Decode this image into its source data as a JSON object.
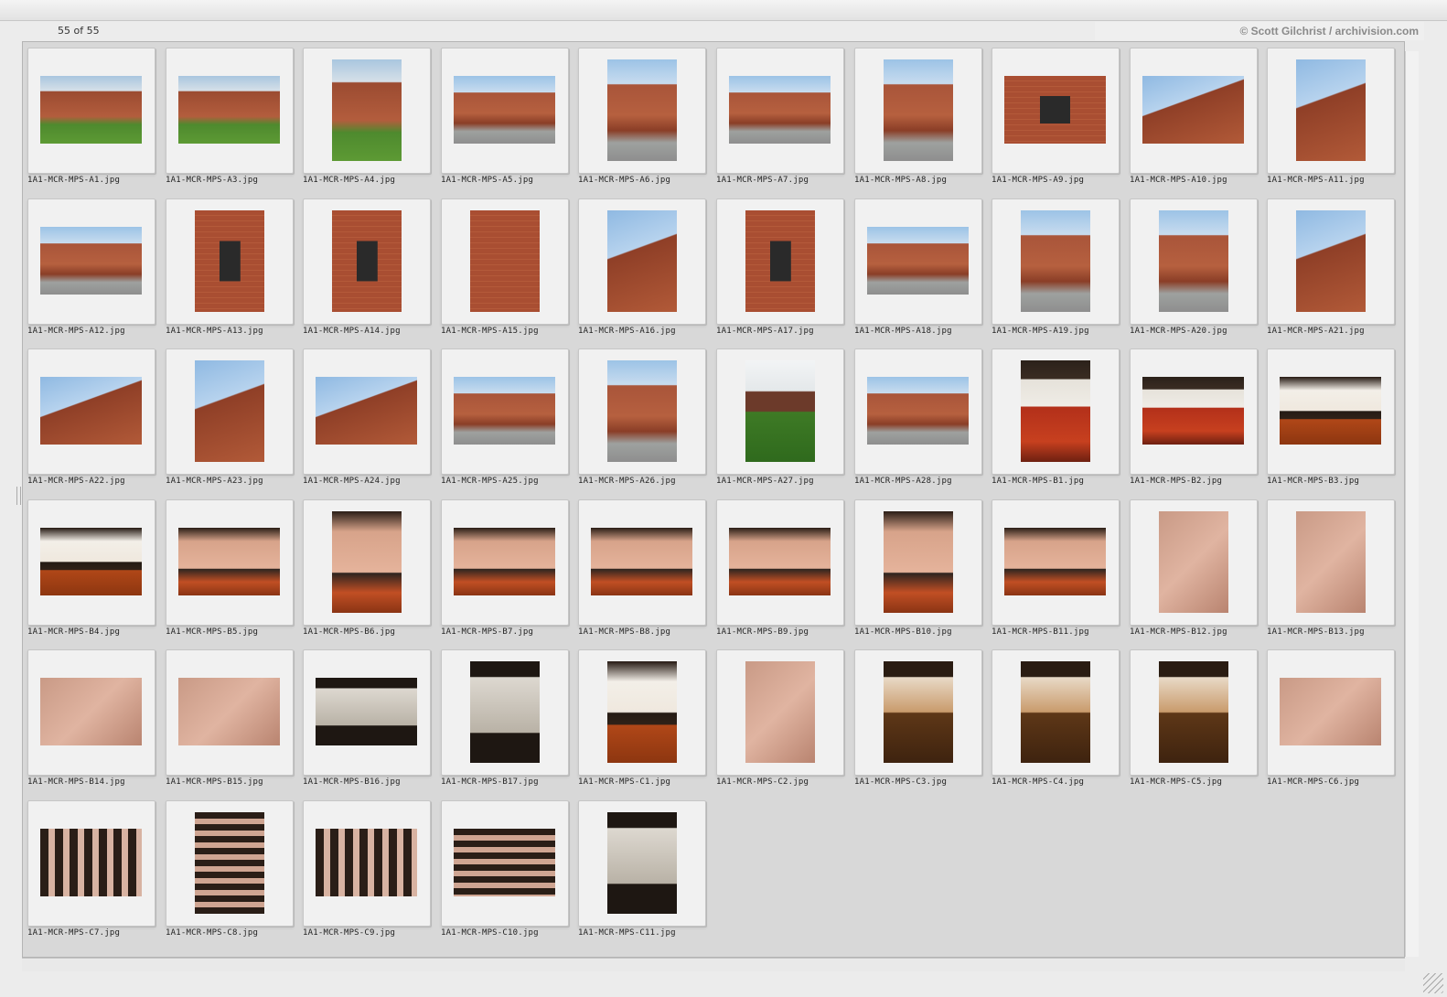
{
  "header": {
    "count_label": "55 of 55",
    "credit": "© Scott Gilchrist / archivision.com"
  },
  "images": [
    {
      "file": "1A1-MCR-MPS-A1.jpg",
      "orientation": "landscape",
      "tone": "exterior-green"
    },
    {
      "file": "1A1-MCR-MPS-A3.jpg",
      "orientation": "landscape",
      "tone": "exterior-green"
    },
    {
      "file": "1A1-MCR-MPS-A4.jpg",
      "orientation": "portrait",
      "tone": "exterior-green"
    },
    {
      "file": "1A1-MCR-MPS-A5.jpg",
      "orientation": "landscape",
      "tone": "exterior"
    },
    {
      "file": "1A1-MCR-MPS-A6.jpg",
      "orientation": "portrait",
      "tone": "exterior"
    },
    {
      "file": "1A1-MCR-MPS-A7.jpg",
      "orientation": "landscape",
      "tone": "exterior"
    },
    {
      "file": "1A1-MCR-MPS-A8.jpg",
      "orientation": "portrait",
      "tone": "exterior"
    },
    {
      "file": "1A1-MCR-MPS-A9.jpg",
      "orientation": "landscape",
      "tone": "brick-window"
    },
    {
      "file": "1A1-MCR-MPS-A10.jpg",
      "orientation": "landscape",
      "tone": "sky-corner"
    },
    {
      "file": "1A1-MCR-MPS-A11.jpg",
      "orientation": "portrait",
      "tone": "sky-corner"
    },
    {
      "file": "1A1-MCR-MPS-A12.jpg",
      "orientation": "landscape",
      "tone": "exterior"
    },
    {
      "file": "1A1-MCR-MPS-A13.jpg",
      "orientation": "portrait",
      "tone": "brick-window"
    },
    {
      "file": "1A1-MCR-MPS-A14.jpg",
      "orientation": "portrait",
      "tone": "brick-window"
    },
    {
      "file": "1A1-MCR-MPS-A15.jpg",
      "orientation": "portrait",
      "tone": "brick"
    },
    {
      "file": "1A1-MCR-MPS-A16.jpg",
      "orientation": "portrait",
      "tone": "sky-corner"
    },
    {
      "file": "1A1-MCR-MPS-A17.jpg",
      "orientation": "portrait",
      "tone": "brick-window"
    },
    {
      "file": "1A1-MCR-MPS-A18.jpg",
      "orientation": "landscape",
      "tone": "exterior"
    },
    {
      "file": "1A1-MCR-MPS-A19.jpg",
      "orientation": "portrait",
      "tone": "exterior"
    },
    {
      "file": "1A1-MCR-MPS-A20.jpg",
      "orientation": "portrait",
      "tone": "exterior"
    },
    {
      "file": "1A1-MCR-MPS-A21.jpg",
      "orientation": "portrait",
      "tone": "sky-corner"
    },
    {
      "file": "1A1-MCR-MPS-A22.jpg",
      "orientation": "landscape",
      "tone": "sky-corner"
    },
    {
      "file": "1A1-MCR-MPS-A23.jpg",
      "orientation": "portrait",
      "tone": "sky-corner"
    },
    {
      "file": "1A1-MCR-MPS-A24.jpg",
      "orientation": "landscape",
      "tone": "sky-corner"
    },
    {
      "file": "1A1-MCR-MPS-A25.jpg",
      "orientation": "landscape",
      "tone": "exterior"
    },
    {
      "file": "1A1-MCR-MPS-A26.jpg",
      "orientation": "portrait",
      "tone": "exterior"
    },
    {
      "file": "1A1-MCR-MPS-A27.jpg",
      "orientation": "portrait",
      "tone": "green-tower"
    },
    {
      "file": "1A1-MCR-MPS-A28.jpg",
      "orientation": "landscape",
      "tone": "exterior"
    },
    {
      "file": "1A1-MCR-MPS-B1.jpg",
      "orientation": "portrait",
      "tone": "interior-red"
    },
    {
      "file": "1A1-MCR-MPS-B2.jpg",
      "orientation": "landscape",
      "tone": "interior-red"
    },
    {
      "file": "1A1-MCR-MPS-B3.jpg",
      "orientation": "landscape",
      "tone": "interior-hall"
    },
    {
      "file": "1A1-MCR-MPS-B4.jpg",
      "orientation": "landscape",
      "tone": "interior-hall"
    },
    {
      "file": "1A1-MCR-MPS-B5.jpg",
      "orientation": "landscape",
      "tone": "interior-pink"
    },
    {
      "file": "1A1-MCR-MPS-B6.jpg",
      "orientation": "portrait",
      "tone": "interior-pink"
    },
    {
      "file": "1A1-MCR-MPS-B7.jpg",
      "orientation": "landscape",
      "tone": "interior-pink"
    },
    {
      "file": "1A1-MCR-MPS-B8.jpg",
      "orientation": "landscape",
      "tone": "interior-pink"
    },
    {
      "file": "1A1-MCR-MPS-B9.jpg",
      "orientation": "landscape",
      "tone": "interior-pink"
    },
    {
      "file": "1A1-MCR-MPS-B10.jpg",
      "orientation": "portrait",
      "tone": "interior-pink"
    },
    {
      "file": "1A1-MCR-MPS-B11.jpg",
      "orientation": "landscape",
      "tone": "interior-pink"
    },
    {
      "file": "1A1-MCR-MPS-B12.jpg",
      "orientation": "portrait",
      "tone": "pink-wall"
    },
    {
      "file": "1A1-MCR-MPS-B13.jpg",
      "orientation": "portrait",
      "tone": "pink-wall"
    },
    {
      "file": "1A1-MCR-MPS-B14.jpg",
      "orientation": "landscape",
      "tone": "pink-wall"
    },
    {
      "file": "1A1-MCR-MPS-B15.jpg",
      "orientation": "landscape",
      "tone": "pink-wall"
    },
    {
      "file": "1A1-MCR-MPS-B16.jpg",
      "orientation": "landscape",
      "tone": "window-dark"
    },
    {
      "file": "1A1-MCR-MPS-B17.jpg",
      "orientation": "portrait",
      "tone": "window-dark"
    },
    {
      "file": "1A1-MCR-MPS-C1.jpg",
      "orientation": "portrait",
      "tone": "interior-hall"
    },
    {
      "file": "1A1-MCR-MPS-C2.jpg",
      "orientation": "portrait",
      "tone": "pink-wall"
    },
    {
      "file": "1A1-MCR-MPS-C3.jpg",
      "orientation": "portrait",
      "tone": "stair"
    },
    {
      "file": "1A1-MCR-MPS-C4.jpg",
      "orientation": "portrait",
      "tone": "stair"
    },
    {
      "file": "1A1-MCR-MPS-C5.jpg",
      "orientation": "portrait",
      "tone": "stair"
    },
    {
      "file": "1A1-MCR-MPS-C6.jpg",
      "orientation": "landscape",
      "tone": "pink-wall"
    },
    {
      "file": "1A1-MCR-MPS-C7.jpg",
      "orientation": "landscape",
      "tone": "dark-beams"
    },
    {
      "file": "1A1-MCR-MPS-C8.jpg",
      "orientation": "portrait",
      "tone": "dark-beams2"
    },
    {
      "file": "1A1-MCR-MPS-C9.jpg",
      "orientation": "landscape",
      "tone": "dark-beams"
    },
    {
      "file": "1A1-MCR-MPS-C10.jpg",
      "orientation": "landscape",
      "tone": "dark-beams2"
    },
    {
      "file": "1A1-MCR-MPS-C11.jpg",
      "orientation": "portrait",
      "tone": "window-dark"
    }
  ]
}
